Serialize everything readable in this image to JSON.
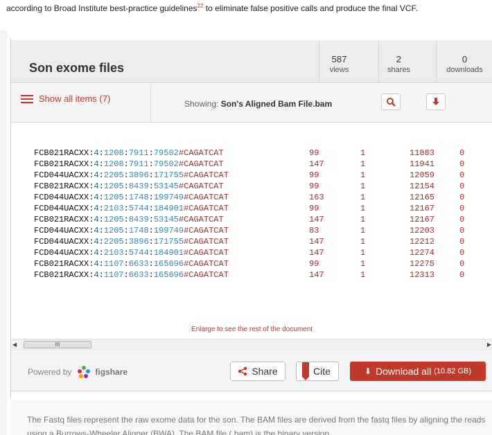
{
  "intro": {
    "text_before": "according to Broad Institute best-practice guidelines",
    "cite_marker": "22",
    "text_after": " to eliminate false positive calls and produce the final VCF."
  },
  "widget": {
    "title": "Son exome files",
    "stats": [
      {
        "value": "587",
        "label": "views"
      },
      {
        "value": "2",
        "label": "shares"
      },
      {
        "value": "0",
        "label": "downloads"
      }
    ]
  },
  "toolbar": {
    "show_all_label": "Show all items (7)",
    "showing_prefix": "Showing:",
    "showing_file": "Son's Aligned Bam File.bam",
    "search_icon": "search-icon",
    "download_icon": "download-arrow-icon"
  },
  "preview": {
    "rows": [
      {
        "fc": "FCB021RACXX",
        "lane": "4",
        "a": "1208",
        "b": "7911",
        "c": "79502",
        "tag": "#CAGATCAT",
        "flag": "99",
        "rname": "1",
        "pos": "11883",
        "mapq": "0"
      },
      {
        "fc": "FCB021RACXX",
        "lane": "4",
        "a": "1208",
        "b": "7911",
        "c": "79502",
        "tag": "#CAGATCAT",
        "flag": "147",
        "rname": "1",
        "pos": "11941",
        "mapq": "0"
      },
      {
        "fc": "FCD044UACXX",
        "lane": "4",
        "a": "2205",
        "b": "3896",
        "c": "171755",
        "tag": "#CAGATCAT",
        "flag": "99",
        "rname": "1",
        "pos": "12059",
        "mapq": "0"
      },
      {
        "fc": "FCB021RACXX",
        "lane": "4",
        "a": "1205",
        "b": "8439",
        "c": "53145",
        "tag": "#CAGATCAT",
        "flag": "99",
        "rname": "1",
        "pos": "12154",
        "mapq": "0"
      },
      {
        "fc": "FCD044UACXX",
        "lane": "4",
        "a": "1205",
        "b": "1748",
        "c": "199749",
        "tag": "#CAGATCAT",
        "flag": "163",
        "rname": "1",
        "pos": "12165",
        "mapq": "0"
      },
      {
        "fc": "FCD044UACXX",
        "lane": "4",
        "a": "2103",
        "b": "5744",
        "c": "184901",
        "tag": "#CAGATCAT",
        "flag": "99",
        "rname": "1",
        "pos": "12167",
        "mapq": "0"
      },
      {
        "fc": "FCB021RACXX",
        "lane": "4",
        "a": "1205",
        "b": "8439",
        "c": "53145",
        "tag": "#CAGATCAT",
        "flag": "147",
        "rname": "1",
        "pos": "12167",
        "mapq": "0"
      },
      {
        "fc": "FCD044UACXX",
        "lane": "4",
        "a": "1205",
        "b": "1748",
        "c": "199749",
        "tag": "#CAGATCAT",
        "flag": "83",
        "rname": "1",
        "pos": "12203",
        "mapq": "0"
      },
      {
        "fc": "FCD044UACXX",
        "lane": "4",
        "a": "2205",
        "b": "3896",
        "c": "171755",
        "tag": "#CAGATCAT",
        "flag": "147",
        "rname": "1",
        "pos": "12212",
        "mapq": "0"
      },
      {
        "fc": "FCD044UACXX",
        "lane": "4",
        "a": "2103",
        "b": "5744",
        "c": "184901",
        "tag": "#CAGATCAT",
        "flag": "147",
        "rname": "1",
        "pos": "12274",
        "mapq": "0"
      },
      {
        "fc": "FCB021RACXX",
        "lane": "4",
        "a": "1107",
        "b": "6633",
        "c": "165696",
        "tag": "#CAGATCAT",
        "flag": "99",
        "rname": "1",
        "pos": "12275",
        "mapq": "0"
      },
      {
        "fc": "FCB021RACXX",
        "lane": "4",
        "a": "1107",
        "b": "6633",
        "c": "165696",
        "tag": "#CAGATCAT",
        "flag": "147",
        "rname": "1",
        "pos": "12313",
        "mapq": "0"
      }
    ],
    "enlarge_text": "Enlarge to see the rest of the document",
    "scroll_thumb_glyph": "III"
  },
  "footer": {
    "powered_by": "Powered by",
    "figshare": "figshare",
    "share_label": "Share",
    "cite_label": "Cite",
    "download_all_label": "Download all",
    "download_all_size": "(10.82 GB)"
  },
  "description": {
    "text": "The Fastq files represent the raw exome data for the son. The BAM files are derived from the fastq files by aligning the reads using a Burrows-Wheeler Aligner (BWA). The BAM file (.bam) is the binary version"
  },
  "colors": {
    "accent": "#c0392b",
    "header_bg": "#ececec",
    "lane_teal": "#0c7b82",
    "coord_blue": "#2f8fc0"
  }
}
